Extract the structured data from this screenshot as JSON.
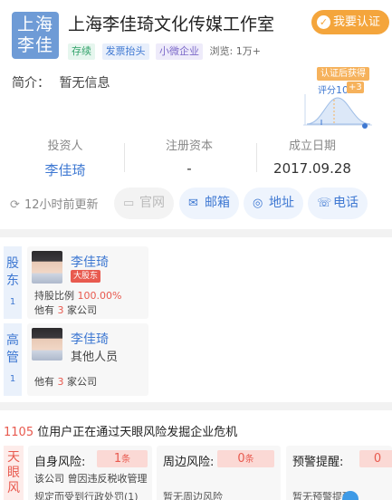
{
  "company": {
    "logo_line1": "上海",
    "logo_line2": "李佳",
    "name": "上海李佳琦文化传媒工作室",
    "certify_label": "我要认证",
    "tags": [
      "存续",
      "发票抬头",
      "小微企业"
    ],
    "views": "浏览: 1万+",
    "intro_label": "简介：",
    "intro_value": "暂无信息"
  },
  "score": {
    "badge": "认证后获得",
    "label": "评分",
    "value": "10",
    "plus": "+3"
  },
  "stats": [
    {
      "label": "投资人",
      "value": "李佳琦"
    },
    {
      "label": "注册资本",
      "value": "-"
    },
    {
      "label": "成立日期",
      "value": "2017.09.28"
    }
  ],
  "actions": {
    "updated": "12小时前更新",
    "website": "官网",
    "email": "邮箱",
    "address": "地址",
    "phone": "电话"
  },
  "shareholders": {
    "label_top": "股",
    "label_bottom": "东",
    "count": "1",
    "person": {
      "name": "李佳琦",
      "badge": "大股东",
      "ratio_label": "持股比例",
      "ratio_value": "100.00%",
      "companies_prefix": "他有",
      "companies_count": "3",
      "companies_suffix": "家公司"
    }
  },
  "executives": {
    "label_top": "高",
    "label_bottom": "管",
    "count": "1",
    "person": {
      "name": "李佳琦",
      "role": "其他人员",
      "companies_prefix": "他有",
      "companies_count": "3",
      "companies_suffix": "家公司"
    }
  },
  "risk": {
    "count": "1105",
    "headline": "位用户正在通过天眼风险发掘企业危机",
    "side_chars": [
      "天",
      "眼",
      "风"
    ],
    "self": {
      "title": "自身风险:",
      "value": "1",
      "unit": "条",
      "desc1": "该公司 曾因违反税收管理",
      "desc2": "规定而受到行政处罚(1)"
    },
    "around": {
      "title": "周边风险:",
      "value": "0",
      "unit": "条",
      "desc2": "暂无周边风险"
    },
    "warning": {
      "title": "预警提醒:",
      "value": "0",
      "desc2": "暂无预警提醒"
    }
  },
  "colors": {
    "accent_blue": "#3e78d2",
    "cert_orange": "#f4a53c",
    "risk_red": "#e85a4f",
    "logo_blue": "#6e9bd6"
  }
}
